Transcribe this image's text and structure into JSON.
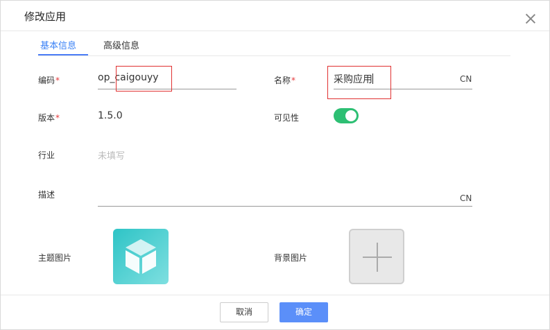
{
  "dialog": {
    "title": "修改应用"
  },
  "tabs": [
    {
      "label": "基本信息",
      "active": true
    },
    {
      "label": "高级信息",
      "active": false
    }
  ],
  "form": {
    "code": {
      "label": "编码",
      "required_mark": "*",
      "value": "op_caigouyy"
    },
    "name": {
      "label": "名称",
      "required_mark": "*",
      "value": "采购应用",
      "lang": "CN"
    },
    "version": {
      "label": "版本",
      "required_mark": "*",
      "value": "1.5.0"
    },
    "visibility": {
      "label": "可见性",
      "enabled": true
    },
    "industry": {
      "label": "行业",
      "placeholder": "未填写"
    },
    "description": {
      "label": "描述",
      "value": "",
      "lang": "CN"
    },
    "theme_image": {
      "label": "主题图片",
      "icon": "cube-icon"
    },
    "background_image": {
      "label": "背景图片",
      "icon": "plus-icon"
    }
  },
  "footer": {
    "cancel_label": "取消",
    "confirm_label": "确定"
  },
  "colors": {
    "accent": "#4a7cf6",
    "toggle_on": "#2dbf73",
    "required": "#e4393c",
    "highlight_box": "#e03030"
  }
}
